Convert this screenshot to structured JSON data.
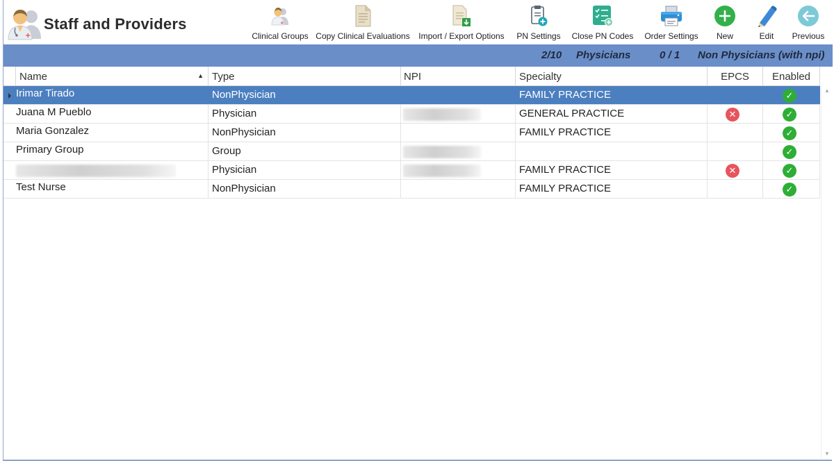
{
  "app": {
    "title": "Staff and Providers"
  },
  "toolbar": {
    "items": [
      {
        "label": "Clinical Groups",
        "icon": "clinical-groups-icon"
      },
      {
        "label": "Copy Clinical Evaluations",
        "icon": "copy-document-icon"
      },
      {
        "label": "Import / Export Options",
        "icon": "import-export-icon"
      },
      {
        "label": "PN Settings",
        "icon": "clipboard-plus-icon"
      },
      {
        "label": "Close PN Codes",
        "icon": "checklist-icon"
      },
      {
        "label": "Order Settings",
        "icon": "printer-icon"
      },
      {
        "label": "New",
        "icon": "plus-circle-icon"
      },
      {
        "label": "Edit",
        "icon": "pencil-icon"
      },
      {
        "label": "Previous",
        "icon": "arrow-left-circle-icon"
      }
    ]
  },
  "summary": {
    "physicians_count": "2/10",
    "physicians_label": "Physicians",
    "nonphysicians_count": "0 / 1",
    "nonphysicians_label": "Non Physicians (with npi)"
  },
  "grid": {
    "columns": [
      "Name",
      "Type",
      "NPI",
      "Specialty",
      "EPCS",
      "Enabled"
    ],
    "rows": [
      {
        "name": "Irimar Tirado",
        "type": "NonPhysician",
        "npi": "",
        "specialty": "FAMILY PRACTICE",
        "epcs": "",
        "enabled": "yes",
        "selected": true
      },
      {
        "name": "Juana M Pueblo",
        "type": "Physician",
        "npi": "[redacted]",
        "specialty": "GENERAL PRACTICE",
        "epcs": "no",
        "enabled": "yes"
      },
      {
        "name": "Maria Gonzalez",
        "type": "NonPhysician",
        "npi": "",
        "specialty": "FAMILY PRACTICE",
        "epcs": "",
        "enabled": "yes"
      },
      {
        "name": "Primary Group",
        "type": "Group",
        "npi": "[redacted]",
        "specialty": "",
        "epcs": "",
        "enabled": "yes"
      },
      {
        "name": "[redacted]",
        "type": "Physician",
        "npi": "[redacted]",
        "specialty": "FAMILY PRACTICE",
        "epcs": "no",
        "enabled": "yes"
      },
      {
        "name": "Test Nurse",
        "type": "NonPhysician",
        "npi": "",
        "specialty": "FAMILY PRACTICE",
        "epcs": "",
        "enabled": "yes"
      }
    ]
  },
  "colors": {
    "summary_bar": "#6a8ec8",
    "selected_row": "#4c7fbf",
    "ok": "#2eae36",
    "error": "#e8545c"
  }
}
